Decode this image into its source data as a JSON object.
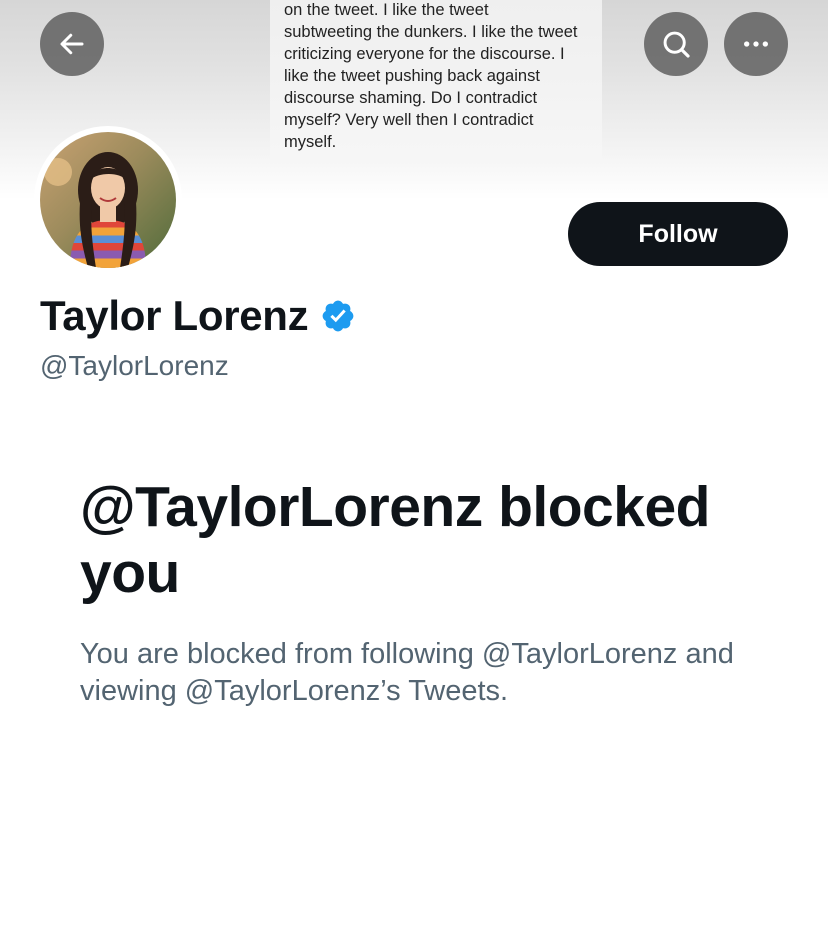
{
  "banner": {
    "text_lines": [
      "on the tweet. I like the tweet",
      "subtweeting the dunkers. I like the tweet",
      "criticizing everyone for the discourse. I",
      "like the tweet pushing back against",
      "discourse shaming. Do I contradict",
      "myself? Very well then I contradict",
      "myself."
    ]
  },
  "header": {
    "back_icon": "arrow-left-icon",
    "search_icon": "search-icon",
    "more_icon": "more-horizontal-icon"
  },
  "profile": {
    "display_name": "Taylor Lorenz",
    "handle": "@TaylorLorenz",
    "verified": true,
    "verified_color": "#1d9bf0",
    "follow_label": "Follow"
  },
  "blocked": {
    "title": "@TaylorLorenz blocked you",
    "description": "You are blocked from following @TaylorLorenz and viewing @TaylorLorenz’s Tweets."
  },
  "colors": {
    "text_primary": "#0f1419",
    "text_secondary": "#536471",
    "follow_bg": "#0f1419",
    "follow_text": "#ffffff"
  }
}
